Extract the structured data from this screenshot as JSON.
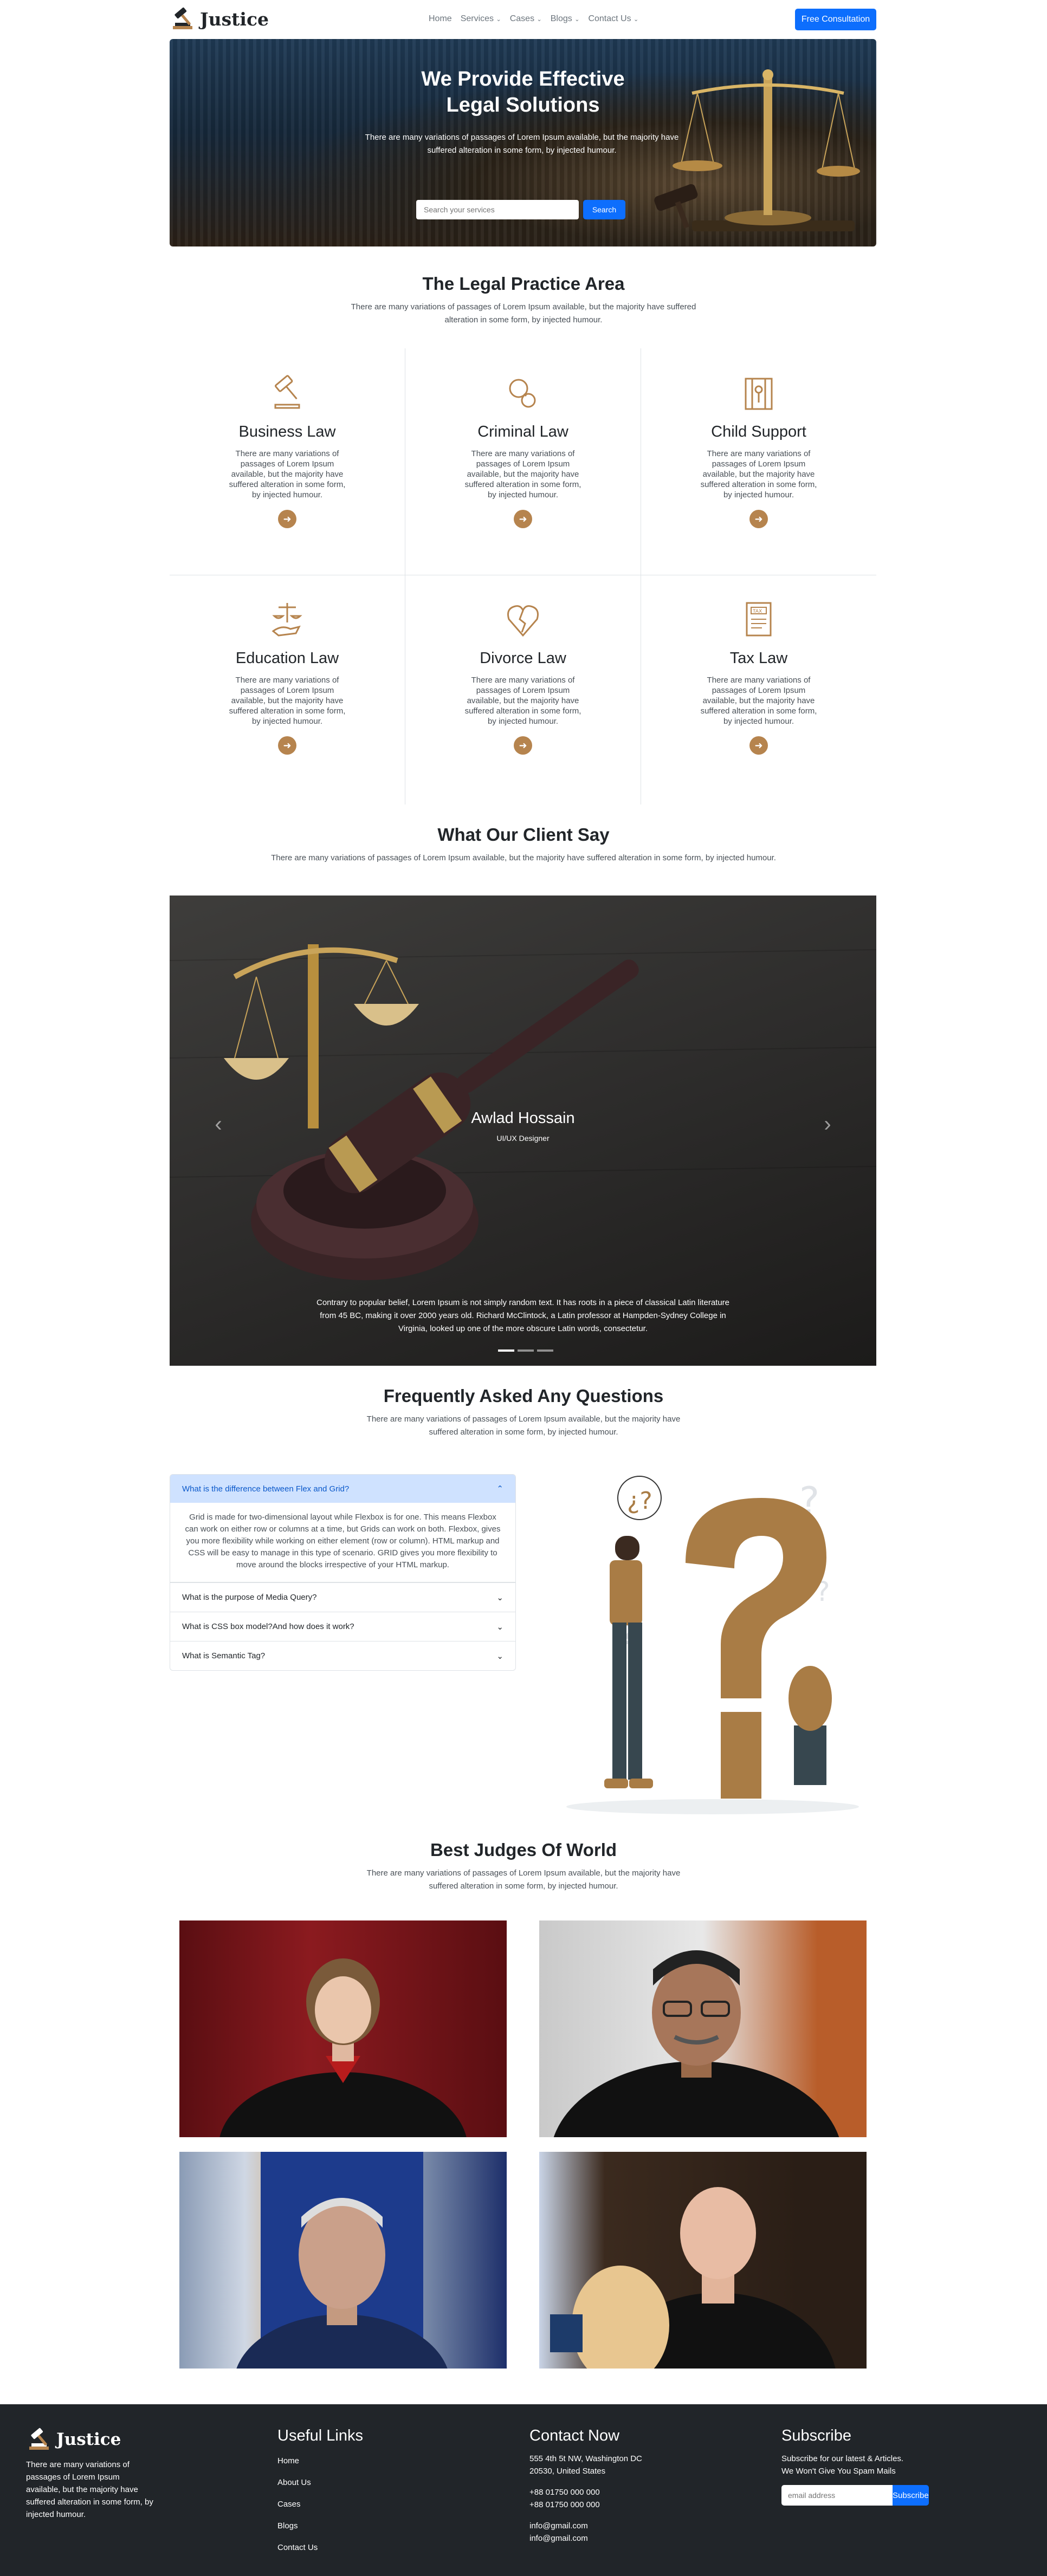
{
  "brand": {
    "name": "Justice"
  },
  "nav": {
    "items": [
      {
        "label": "Home",
        "caret": ""
      },
      {
        "label": "Services",
        "caret": "⌄"
      },
      {
        "label": "Cases",
        "caret": "⌄"
      },
      {
        "label": "Blogs",
        "caret": "⌄"
      },
      {
        "label": "Contact Us",
        "caret": "⌄"
      }
    ],
    "cta": "Free Consultation"
  },
  "hero": {
    "title_line1": "We Provide Effective",
    "title_line2": "Legal Solutions",
    "subtitle": "There are many variations of passages of Lorem Ipsum available, but the majority have suffered alteration in some form, by injected humour.",
    "search_placeholder": "Search your services",
    "search_button": "Search"
  },
  "practice": {
    "title": "The Legal Practice Area",
    "subtitle": "There are many variations of passages of Lorem Ipsum available, but the majority have suffered alteration in some form, by injected humour.",
    "items": [
      {
        "title": "Business Law",
        "icon": "gavel-icon",
        "text": "There are many variations of passages of Lorem Ipsum available, but the majority have suffered alteration in some form, by injected humour."
      },
      {
        "title": "Criminal Law",
        "icon": "handcuffs-icon",
        "text": "There are many variations of passages of Lorem Ipsum available, but the majority have suffered alteration in some form, by injected humour."
      },
      {
        "title": "Child Support",
        "icon": "child-icon",
        "text": "There are many variations of passages of Lorem Ipsum available, but the majority have suffered alteration in some form, by injected humour."
      },
      {
        "title": "Education Law",
        "icon": "scales-hand-icon",
        "text": "There are many variations of passages of Lorem Ipsum available, but the majority have suffered alteration in some form, by injected humour."
      },
      {
        "title": "Divorce Law",
        "icon": "broken-heart-icon",
        "text": "There are many variations of passages of Lorem Ipsum available, but the majority have suffered alteration in some form, by injected humour."
      },
      {
        "title": "Tax Law",
        "icon": "tax-document-icon",
        "text": "There are many variations of passages of Lorem Ipsum available, but the majority have suffered alteration in some form, by injected humour."
      }
    ],
    "accent": "#b6844e"
  },
  "testimonials": {
    "title": "What Our Client Say",
    "subtitle": "There are many variations of passages of Lorem Ipsum available, but the majority have suffered alteration in some form, by injected humour.",
    "name": "Awlad Hossain",
    "role": "UI/UX Designer",
    "quote": "Contrary to popular belief, Lorem Ipsum is not simply random text. It has roots in a piece of classical Latin literature from 45 BC, making it over 2000 years old. Richard McClintock, a Latin professor at Hampden-Sydney College in Virginia, looked up one of the more obscure Latin words, consectetur.",
    "prev_icon": "‹",
    "next_icon": "›"
  },
  "faq": {
    "title": "Frequently Asked Any Questions",
    "subtitle": "There are many variations of passages of Lorem Ipsum available, but the majority have suffered alteration in some form, by injected humour.",
    "items": [
      {
        "q": "What is the difference between Flex and Grid?",
        "a": "Grid is made for two-dimensional layout while Flexbox is for one. This means Flexbox can work on either row or columns at a time, but Grids can work on both. Flexbox, gives you more flexibility while working on either element (row or column). HTML markup and CSS will be easy to manage in this type of scenario. GRID gives you more flexibility to move around the blocks irrespective of your HTML markup.",
        "open": true
      },
      {
        "q": "What is the purpose of Media Query?",
        "open": false
      },
      {
        "q": "What is CSS box model?And how does it work?",
        "open": false
      },
      {
        "q": "What is Semantic Tag?",
        "open": false
      }
    ]
  },
  "judges": {
    "title": "Best Judges Of World",
    "subtitle": "There are many variations of passages of Lorem Ipsum available, but the majority have suffered alteration in some form, by injected humour."
  },
  "footer": {
    "brand_name": "Justice",
    "about": "There are many variations of passages of Lorem Ipsum available, but the majority have suffered alteration in some form, by injected humour.",
    "links_title": "Useful Links",
    "links": [
      "Home",
      "About Us",
      "Cases",
      "Blogs",
      "Contact Us"
    ],
    "contact_title": "Contact Now",
    "address": "555 4th 5t NW, Washington DC 20530, United States",
    "phone1": "+88 01750 000 000",
    "phone2": "+88 01750 000 000",
    "email1": "info@gmail.com",
    "email2": "info@gmail.com",
    "subscribe_title": "Subscribe",
    "subscribe_text": "Subscribe for our latest & Articles. We Won't Give You Spam Mails",
    "email_placeholder": "email address",
    "subscribe_button": "Subscribe"
  }
}
